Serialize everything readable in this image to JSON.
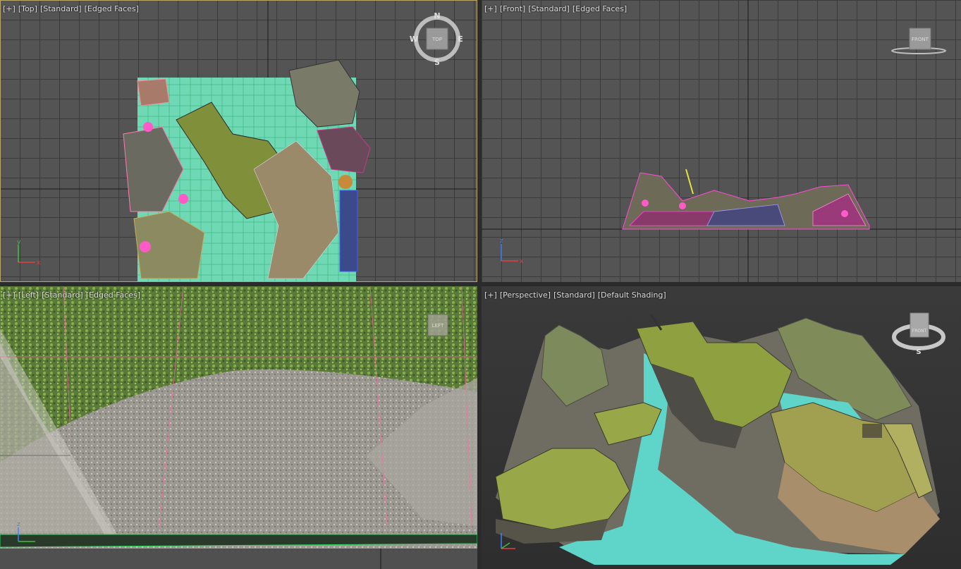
{
  "viewports": {
    "top": {
      "menu_plus": "[+]",
      "view": "[Top]",
      "shading": "[Standard]",
      "mode": "[Edged Faces]",
      "viewcube_face": "TOP",
      "compass": {
        "n": "N",
        "s": "S",
        "e": "E",
        "w": "W"
      }
    },
    "front": {
      "menu_plus": "[+]",
      "view": "[Front]",
      "shading": "[Standard]",
      "mode": "[Edged Faces]",
      "viewcube_face": "FRONT"
    },
    "left": {
      "menu_plus": "[+]",
      "view": "[Left]",
      "shading": "[Standard]",
      "mode": "[Edged Faces]",
      "viewcube_face": "LEFT"
    },
    "perspective": {
      "menu_plus": "[+]",
      "view": "[Perspective]",
      "shading": "[Standard]",
      "mode": "[Default Shading]",
      "viewcube_face": "FRONT",
      "compass_s": "S"
    }
  },
  "axis_labels": {
    "x": "x",
    "y": "y",
    "z": "z"
  },
  "colors": {
    "viewport_bg": "#545454",
    "active_border": "#b9a86a",
    "water": "#5fd4c8",
    "grass": "#8a9a3a",
    "rock": "#8c8a80"
  }
}
